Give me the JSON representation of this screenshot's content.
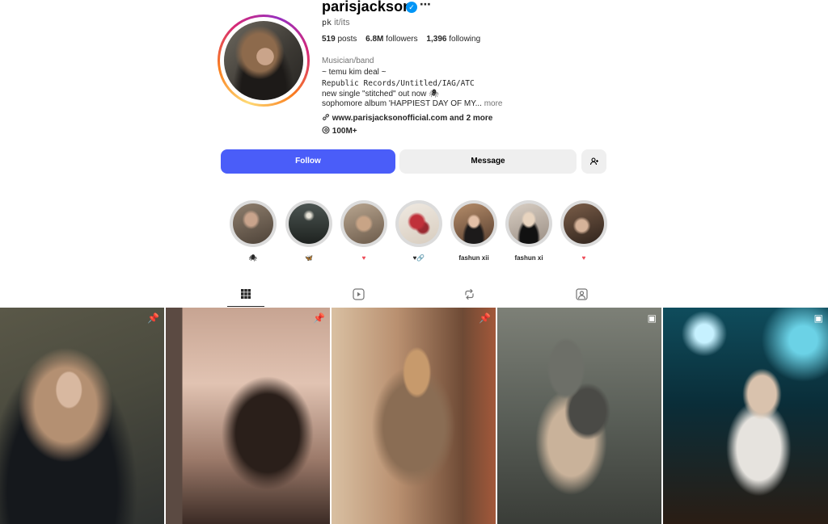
{
  "profile": {
    "username": "parisjackson",
    "verified_mark": "✓",
    "more_icon": "⋯",
    "display_name": "pk",
    "pronouns": "it/its",
    "stats": {
      "posts_num": "519",
      "posts_label": "posts",
      "followers_num": "6.8M",
      "followers_label": "followers",
      "following_num": "1,396",
      "following_label": "following"
    },
    "category": "Musician/band",
    "bio_lines": [
      "~ temu kim deal ~",
      "Republic Records/Untitled/IAG/ATC",
      "new single \"stitched\" out now 🕷",
      "sophomore album 'HAPPIEST DAY OF MY..."
    ],
    "bio_more": "more",
    "link_text": "www.parisjacksonofficial.com and 2 more",
    "threads_count": "100M+"
  },
  "buttons": {
    "follow": "Follow",
    "message": "Message"
  },
  "highlights": [
    {
      "label": "🕷"
    },
    {
      "label": "🦋"
    },
    {
      "label": "♥"
    },
    {
      "label": "♥🔗"
    },
    {
      "label": "fashun xii"
    },
    {
      "label": "fashun xi"
    },
    {
      "label": "♥"
    }
  ],
  "tabs": [
    "posts-tab",
    "reels-tab",
    "reposts-tab",
    "tagged-tab"
  ],
  "grid": {
    "badges": [
      "📌",
      "📌",
      "📌",
      "▣",
      "▣"
    ]
  },
  "colors": {
    "follow_button": "#4a5df9",
    "secondary_button": "#efefef",
    "verified_badge": "#0095f6",
    "heart_pink": "#ed4956"
  }
}
